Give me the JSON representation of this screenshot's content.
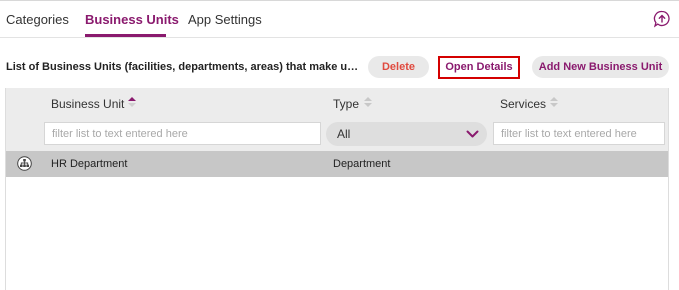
{
  "tabs": [
    {
      "label": "Categories",
      "active": false
    },
    {
      "label": "Business Units",
      "active": true
    },
    {
      "label": "App Settings",
      "active": false
    }
  ],
  "accent_color": "#8a1a6e",
  "help_icon": "upload-bubble-icon",
  "toolbar": {
    "description": "List of Business Units (facilities, departments, areas) that make up y...",
    "delete_label": "Delete",
    "open_details_label": "Open Details",
    "add_label": "Add New Business Unit"
  },
  "grid": {
    "columns": {
      "business_unit": "Business Unit",
      "type": "Type",
      "services": "Services"
    },
    "sort": {
      "column": "Business Unit",
      "direction": "ascending"
    },
    "filters": {
      "business_unit_placeholder": "filter list to text entered here",
      "type_selected": "All",
      "services_placeholder": "filter list to text entered here"
    },
    "rows": [
      {
        "icon": "org-hierarchy-icon",
        "name": "HR Department",
        "type": "Department",
        "services": ""
      }
    ]
  }
}
